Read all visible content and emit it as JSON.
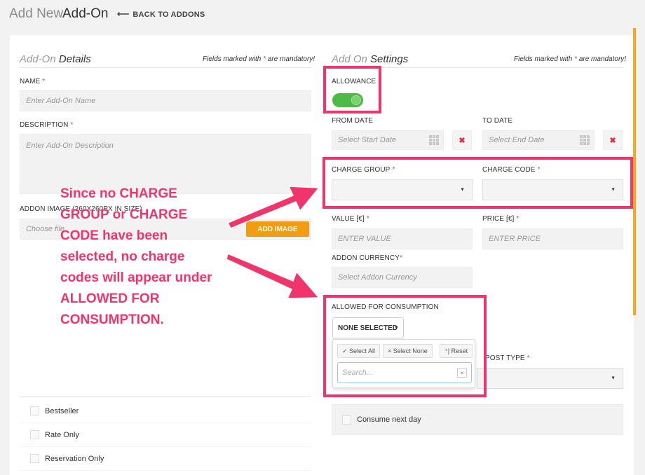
{
  "header": {
    "title_light": "Add New",
    "title_dark": "Add-On",
    "back_link": "BACK TO ADDONS"
  },
  "details": {
    "title_light": "Add-On",
    "title_dark": "Details",
    "mandatory_prefix": "Fields marked with",
    "mandatory_star": "*",
    "mandatory_suffix": "are mandatory!",
    "name_label": "NAME",
    "name_placeholder": "Enter Add-On Name",
    "description_label": "DESCRIPTION",
    "description_placeholder": "Enter Add-On Description",
    "image_label": "ADDON IMAGE (260X260PX IN SIZE)",
    "image_placeholder": "Choose file",
    "add_image_button": "ADD IMAGE",
    "checkboxes": [
      {
        "label": "Bestseller"
      },
      {
        "label": "Rate Only"
      },
      {
        "label": "Reservation Only"
      }
    ]
  },
  "settings": {
    "title_light": "Add On",
    "title_dark": "Settings",
    "mandatory_prefix": "Fields marked with",
    "mandatory_star": "*",
    "mandatory_suffix": "are mandatory!",
    "allowance_label": "ALLOWANCE",
    "allowance_on": true,
    "from_date_label": "FROM DATE",
    "from_date_placeholder": "Select Start Date",
    "to_date_label": "TO DATE",
    "to_date_placeholder": "Select End Date",
    "clear_symbol": "✖",
    "charge_group_label": "CHARGE GROUP",
    "charge_code_label": "CHARGE CODE",
    "value_label": "VALUE [€]",
    "value_placeholder": "ENTER VALUE",
    "price_label": "PRICE [€]",
    "price_placeholder": "ENTER PRICE",
    "currency_label": "ADDON CURRENCY",
    "currency_placeholder": "Select Addon Currency",
    "consumption_label": "ALLOWED FOR CONSUMPTION",
    "none_selected": "NONE SELECTED",
    "select_all": "✓ Select All",
    "select_none": "× Select None",
    "reset": "⁺| Reset",
    "search_placeholder": "Search...",
    "search_clear": "×",
    "post_type_label": "POST TYPE",
    "consume_next_day": "Consume next day"
  },
  "annotation": {
    "lines": [
      "Since no CHARGE",
      "GROUP or CHARGE",
      "CODE have been",
      "selected, no charge",
      "codes will appear under",
      "ALLOWED FOR",
      "CONSUMPTION."
    ],
    "color": "#f0346c"
  },
  "colors": {
    "accent": "#f39c12",
    "toggle_on": "#4cb948",
    "required": "#e2435c",
    "highlight": "#f0346c"
  }
}
